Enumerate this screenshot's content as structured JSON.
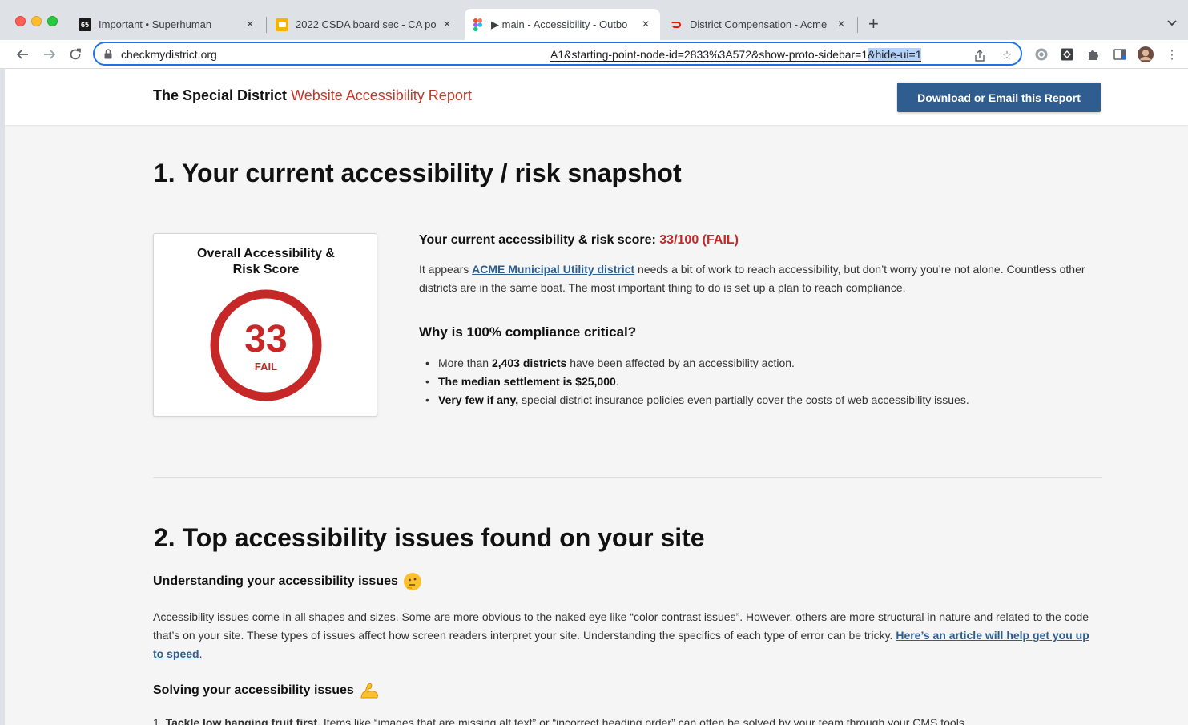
{
  "browser": {
    "tabs": [
      {
        "favicon": "superhuman-icon",
        "badge": "65",
        "title": "Important • Superhuman",
        "active": false
      },
      {
        "favicon": "google-slides-icon",
        "title": "2022 CSDA board sec - CA po",
        "active": false
      },
      {
        "favicon": "figma-icon",
        "title": "▶ main - Accessibility - Outbo",
        "active": true
      },
      {
        "favicon": "doordash-icon",
        "title": "District Compensation - Acme",
        "active": false
      }
    ],
    "address_host": "checkmydistrict.org",
    "address_tail_plain": "A1&starting-point-node-id=2833%3A572&show-proto-sidebar=1",
    "address_tail_selected": "&hide-ui=1"
  },
  "site": {
    "brand_bold": "The Special District",
    "brand_accent": "Website Accessibility Report",
    "download_label": "Download or Email this Report"
  },
  "section1": {
    "heading": "1. Your current accessibility / risk snapshot",
    "card_label": "Overall Accessibility & Risk Score",
    "score": 33,
    "score_display": "33",
    "score_max": 100,
    "status": "FAIL",
    "score_heading_prefix": "Your current accessibility & risk score: ",
    "score_heading_value": "33/100 (FAIL)",
    "intro_prefix": "It appears ",
    "intro_link": "ACME Municipal Utility district",
    "intro_suffix": " needs a bit of work to reach accessibility, but don’t worry you’re not alone. Countless other districts are in the same boat. The most important thing to do is set up a plan to reach compliance.",
    "why_heading": "Why is 100% compliance critical?",
    "bullets": [
      {
        "pre": "More than ",
        "bold": "2,403 districts",
        "post": " have been affected by an accessibility action."
      },
      {
        "pre": "",
        "bold": "The median settlement is $25,000",
        "post": "."
      },
      {
        "pre": "",
        "bold": "Very few if any,",
        "post": " special district insurance policies even partially cover the costs of web accessibility issues."
      }
    ]
  },
  "section2": {
    "heading": "2. Top accessibility issues found on your site",
    "understanding_heading": "Understanding your accessibility issues",
    "understanding_emoji": "thinking-face-icon",
    "understanding_text": "Accessibility issues come in all shapes and sizes. Some are more obvious to the naked eye like “color contrast issues”. However, others are more structural in nature and related to the code that’s on your site. These types of issues affect how screen readers interpret your site. Understanding the specifics of each type of error can be tricky. ",
    "understanding_link": "Here’s an article will help get you up to speed",
    "understanding_end": ".",
    "solving_heading": "Solving your accessibility issues",
    "solving_emoji": "flexed-biceps-icon",
    "list_first_number": "1.",
    "list_first_bold": "Tackle low hanging fruit first.",
    "list_first_text": " Items like “images that are missing alt text” or “incorrect heading order” can often be solved by your team through your CMS tools."
  },
  "colors": {
    "accent_red": "#c62828",
    "brand_blue": "#2f5d8f",
    "page_bg": "#f5f5f5"
  }
}
